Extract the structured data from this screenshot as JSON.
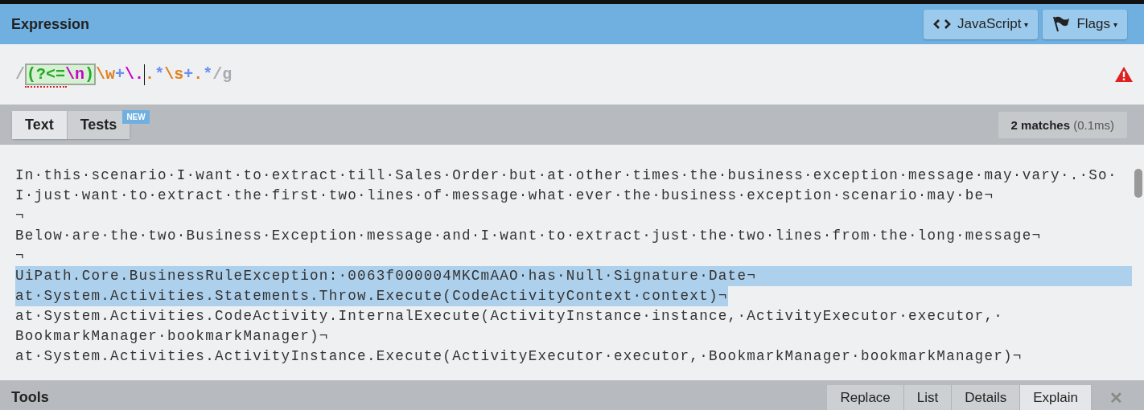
{
  "header": {
    "title": "Expression",
    "buttons": [
      {
        "label": "JavaScript",
        "caret": "▾"
      },
      {
        "label": "Flags",
        "caret": "▾"
      }
    ]
  },
  "expression": {
    "tokens": [
      {
        "kind": "delimiter",
        "text": "/"
      },
      {
        "kind": "group",
        "error": true,
        "children": [
          {
            "kind": "group_paren",
            "text": "(?<="
          },
          {
            "kind": "special",
            "text": "\\n"
          },
          {
            "kind": "group_paren",
            "text": ")"
          }
        ]
      },
      {
        "kind": "class",
        "text": "\\w"
      },
      {
        "kind": "quantifier",
        "text": "+"
      },
      {
        "kind": "special",
        "text": "\\."
      },
      {
        "kind": "cursor"
      },
      {
        "kind": "class",
        "text": "."
      },
      {
        "kind": "quantifier",
        "text": "*"
      },
      {
        "kind": "class",
        "text": "\\s"
      },
      {
        "kind": "quantifier",
        "text": "+"
      },
      {
        "kind": "class",
        "text": "."
      },
      {
        "kind": "quantifier",
        "text": "*"
      },
      {
        "kind": "delimiter",
        "text": "/g"
      }
    ],
    "warning": true
  },
  "tabs": [
    {
      "label": "Text",
      "selected": true
    },
    {
      "label": "Tests",
      "selected": false,
      "badge": "NEW"
    }
  ],
  "match_info": {
    "count": "2 matches",
    "time": "(0.1ms)"
  },
  "text_lines": [
    {
      "text": "In·this·scenario·I·want·to·extract·till·Sales·Order·but·at·other·times·the·business·exception·message·may·vary·.·So·",
      "selected": false
    },
    {
      "text": "I·just·want·to·extract·the·first·two·lines·of·message·what·ever·the·business·exception·scenario·may·be¬",
      "selected": false
    },
    {
      "text": "¬",
      "selected": false
    },
    {
      "text": "Below·are·the·two·Business·Exception·message·and·I·want·to·extract·just·the·two·lines·from·the·long·message¬",
      "selected": false
    },
    {
      "text": "¬",
      "selected": false
    },
    {
      "text": "UiPath.Core.BusinessRuleException:·0063f000004MKCmAAO·has·Null·Signature·Date¬",
      "selected": true,
      "selected_to_end": true
    },
    {
      "text": "at·System.Activities.Statements.Throw.Execute(CodeActivityContext·context)¬",
      "selected": true,
      "selected_to_end": false
    },
    {
      "text": "at·System.Activities.CodeActivity.InternalExecute(ActivityInstance·instance,·ActivityExecutor·executor,·",
      "selected": false
    },
    {
      "text": "BookmarkManager·bookmarkManager)¬",
      "selected": false
    },
    {
      "text": "at·System.Activities.ActivityInstance.Execute(ActivityExecutor·executor,·BookmarkManager·bookmarkManager)¬",
      "selected": false
    }
  ],
  "tools": {
    "title": "Tools",
    "tabs": [
      {
        "label": "Replace",
        "selected": false
      },
      {
        "label": "List",
        "selected": false
      },
      {
        "label": "Details",
        "selected": false
      },
      {
        "label": "Explain",
        "selected": true
      }
    ],
    "close": "✕"
  }
}
